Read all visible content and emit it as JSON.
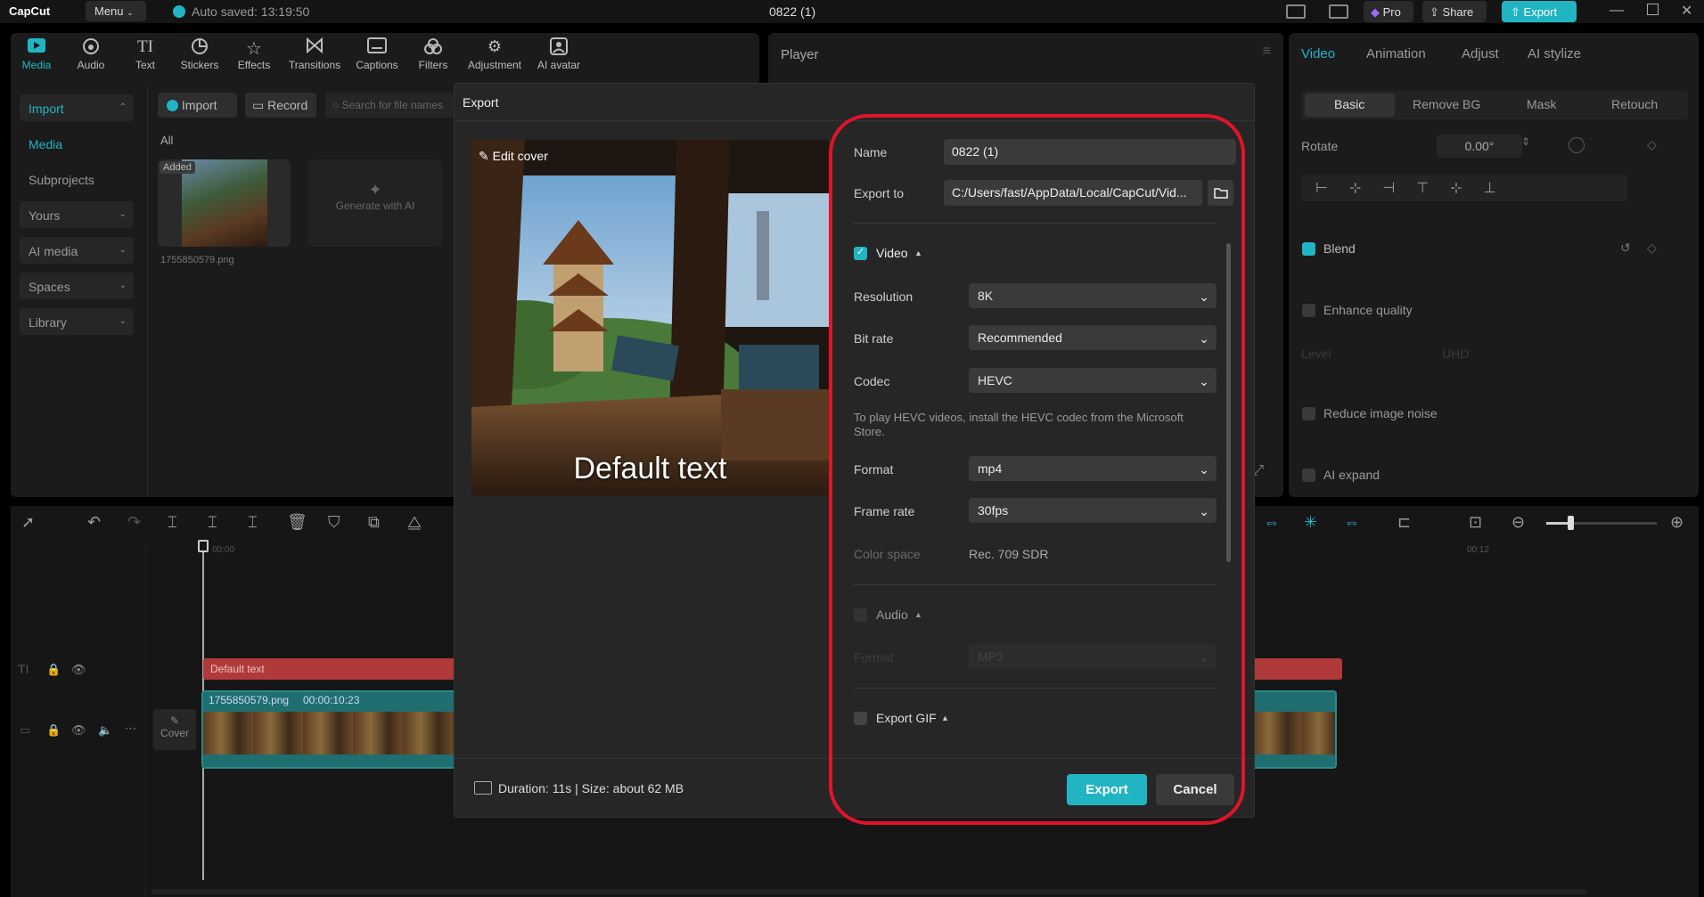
{
  "titlebar": {
    "app_name": "CapCut",
    "menu_label": "Menu",
    "autosave": "Auto saved: 13:19:50",
    "project_title": "0822 (1)",
    "pro_label": "Pro",
    "share_label": "Share",
    "export_label": "Export"
  },
  "toolbar": {
    "items": [
      {
        "label": "Media",
        "icon": "play-square-icon"
      },
      {
        "label": "Audio",
        "icon": "audio-icon"
      },
      {
        "label": "Text",
        "icon": "text-icon"
      },
      {
        "label": "Stickers",
        "icon": "sticker-icon"
      },
      {
        "label": "Effects",
        "icon": "effects-icon"
      },
      {
        "label": "Transitions",
        "icon": "transitions-icon"
      },
      {
        "label": "Captions",
        "icon": "captions-icon"
      },
      {
        "label": "Filters",
        "icon": "filters-icon"
      },
      {
        "label": "Adjustment",
        "icon": "adjustment-icon"
      },
      {
        "label": "AI avatar",
        "icon": "avatar-icon"
      }
    ]
  },
  "sidebar": {
    "import_label": "Import",
    "media_label": "Media",
    "subprojects_label": "Subprojects",
    "yours_label": "Yours",
    "ai_media_label": "AI media",
    "spaces_label": "Spaces",
    "library_label": "Library"
  },
  "media": {
    "import_button": "Import",
    "record_button": "Record",
    "search_placeholder": "Search for file names",
    "filter_all": "All",
    "added_badge": "Added",
    "file_name": "1755850579.png",
    "generate_label": "Generate with AI"
  },
  "player": {
    "title": "Player"
  },
  "right_panel": {
    "tabs": [
      "Video",
      "Animation",
      "Adjust",
      "AI stylize"
    ],
    "subtabs": [
      "Basic",
      "Remove BG",
      "Mask",
      "Retouch"
    ],
    "rotate_label": "Rotate",
    "rotate_value": "0.00°",
    "blend_label": "Blend",
    "enhance_label": "Enhance quality",
    "level_label": "Level",
    "level_value": "UHD",
    "reduce_noise_label": "Reduce image noise",
    "ai_expand_label": "AI expand"
  },
  "timeline": {
    "time_start": "00:00",
    "time_end": "00:12",
    "text_clip": "Default text",
    "video_clip_name": "1755850579.png",
    "video_clip_duration": "00:00:10:23",
    "cover_label": "Cover"
  },
  "export_dialog": {
    "title": "Export",
    "edit_cover_label": "Edit cover",
    "preview_overlay_text": "Default text",
    "name_label": "Name",
    "name_value": "0822 (1)",
    "export_to_label": "Export to",
    "export_to_value": "C:/Users/fast/AppData/Local/CapCut/Vid...",
    "video_section_label": "Video",
    "video_checked": true,
    "resolution_label": "Resolution",
    "resolution_value": "8K",
    "bitrate_label": "Bit rate",
    "bitrate_value": "Recommended",
    "codec_label": "Codec",
    "codec_value": "HEVC",
    "codec_note": "To play HEVC videos, install the HEVC codec from the Microsoft Store.",
    "format_label": "Format",
    "format_value": "mp4",
    "framerate_label": "Frame rate",
    "framerate_value": "30fps",
    "colorspace_label": "Color space",
    "colorspace_value": "Rec. 709 SDR",
    "audio_section_label": "Audio",
    "audio_checked": false,
    "audio_format_label": "Format",
    "audio_format_value": "MP3",
    "gif_section_label": "Export GIF",
    "gif_checked": false,
    "summary": "Duration: 11s | Size: about 62 MB",
    "export_button": "Export",
    "cancel_button": "Cancel"
  },
  "colors": {
    "accent": "#21b5c4",
    "highlight_box": "#e0142a",
    "text_clip": "#b03a3a",
    "video_clip": "#1f6e70"
  }
}
